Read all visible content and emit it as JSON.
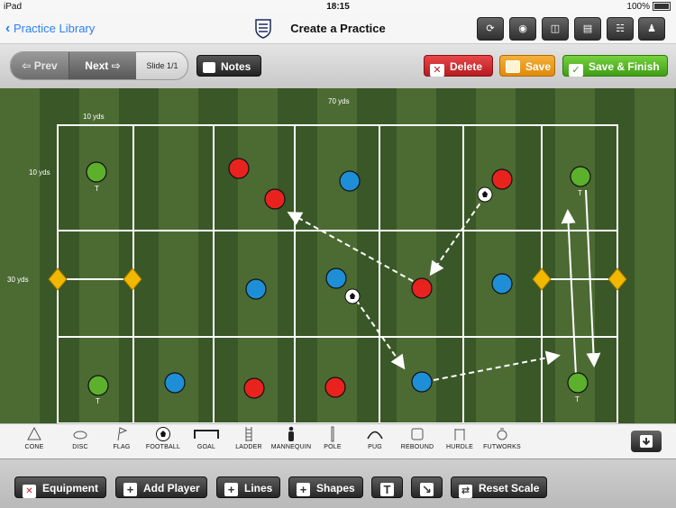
{
  "status": {
    "device": "iPad",
    "time": "18:15",
    "battery": "100%"
  },
  "nav": {
    "back_label": "Practice Library",
    "title": "Create a Practice"
  },
  "toolbar": {
    "prev_label": "Prev",
    "next_label": "Next",
    "slide_label": "Slide 1/1",
    "notes_label": "Notes",
    "delete_label": "Delete",
    "save_label": "Save",
    "finish_label": "Save & Finish"
  },
  "pitch": {
    "width_label": "70 yds",
    "col_label": "10 yds",
    "row_label": "10 yds",
    "height_label": "30 yds",
    "player_tag": "T"
  },
  "equipment": [
    "CONE",
    "DISC",
    "FLAG",
    "FOOTBALL",
    "GOAL",
    "LADDER",
    "MANNEQUIN",
    "POLE",
    "PUG",
    "REBOUND",
    "HURDLE",
    "FUTWORKS"
  ],
  "bottom": {
    "equipment_label": "Equipment",
    "add_player_label": "Add Player",
    "lines_label": "Lines",
    "shapes_label": "Shapes",
    "text_tool": "T",
    "reset_label": "Reset Scale"
  },
  "colors": {
    "red_team": "#e8231d",
    "blue_team": "#1e8fd6",
    "green_team": "#5cb02c",
    "cone": "#f2b800"
  }
}
